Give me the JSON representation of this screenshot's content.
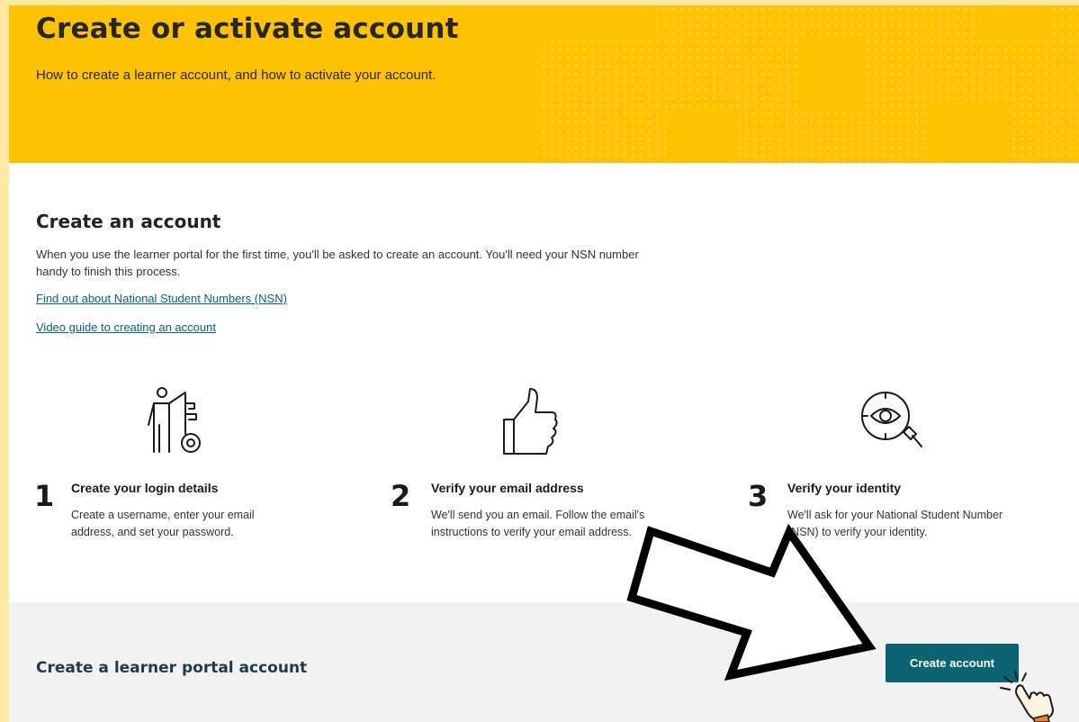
{
  "hero": {
    "title": "Create or activate account",
    "subtitle": "How to create a learner account, and how to activate your account.",
    "color": "#fdc300"
  },
  "create": {
    "title": "Create an account",
    "intro": "When you use the learner portal for the first time, you'll be asked to create an account. You'll need your NSN number handy to finish this process.",
    "links": [
      "Find out about National Student Numbers (NSN)",
      "Video guide to creating an account"
    ]
  },
  "steps": [
    {
      "number": "1",
      "icon": "person-key-icon",
      "title": "Create your login details",
      "text": "Create a username, enter your email address, and set your password."
    },
    {
      "number": "2",
      "icon": "thumbs-up-icon",
      "title": "Verify your email address",
      "text": "We'll send you an email. Follow the email's instructions to verify your email address."
    },
    {
      "number": "3",
      "icon": "eye-search-icon",
      "title": "Verify your identity",
      "text": "We'll ask for your National Student Number (NSN) to verify your identity."
    }
  ],
  "band": {
    "title": "Create a learner portal account",
    "button_label": "Create account",
    "button_color": "#0b6472"
  },
  "annotations": {
    "arrow": "arrow-icon",
    "pointer": "pointing-hand-icon"
  }
}
